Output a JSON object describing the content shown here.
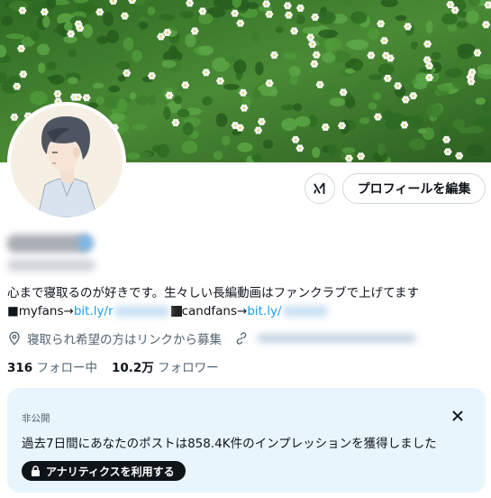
{
  "profile": {
    "edit_button_label": "プロフィールを編集",
    "bio_line1": "心まで寝取るのが好きです。生々しい長編動画はファンクラブで上げてます",
    "bio_line2_prefix": "■myfans→",
    "bio_link1_visible": "bit.ly/r",
    "bio_line2_mid": "candfans→ ",
    "bio_link2_visible": "bit.ly/",
    "location": "寝取られ希望の方はリンクから募集",
    "following_count": "316",
    "following_label": "フォロー中",
    "followers_count": "10.2万",
    "followers_label": "フォロワー"
  },
  "analytics_card": {
    "private_label": "非公開",
    "message": "過去7日間にあなたのポストは858.4K件のインプレッションを獲得しました",
    "button_label": "アナリティクスを利用する"
  },
  "icons": {
    "grok": "grok-icon",
    "location": "location-pin-icon",
    "link": "link-icon",
    "close": "close-icon",
    "lock": "lock-icon"
  },
  "colors": {
    "link": "#1d9bf0",
    "muted": "#536471",
    "card_bg": "#e8f5fd",
    "dark_button": "#0f1419"
  }
}
